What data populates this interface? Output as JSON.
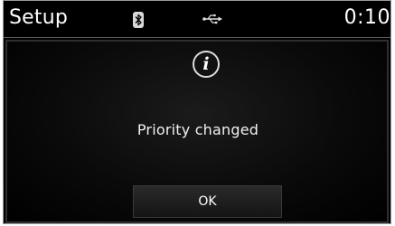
{
  "status_bar": {
    "title": "Setup",
    "clock": "0:10",
    "icons": [
      "bluetooth-icon",
      "usb-icon"
    ]
  },
  "dialog": {
    "icon": "info-icon",
    "icon_glyph": "i",
    "message": "Priority changed",
    "ok_label": "OK"
  },
  "colors": {
    "background": "#000000",
    "text": "#ffffff",
    "button": "#1e1e1e"
  }
}
